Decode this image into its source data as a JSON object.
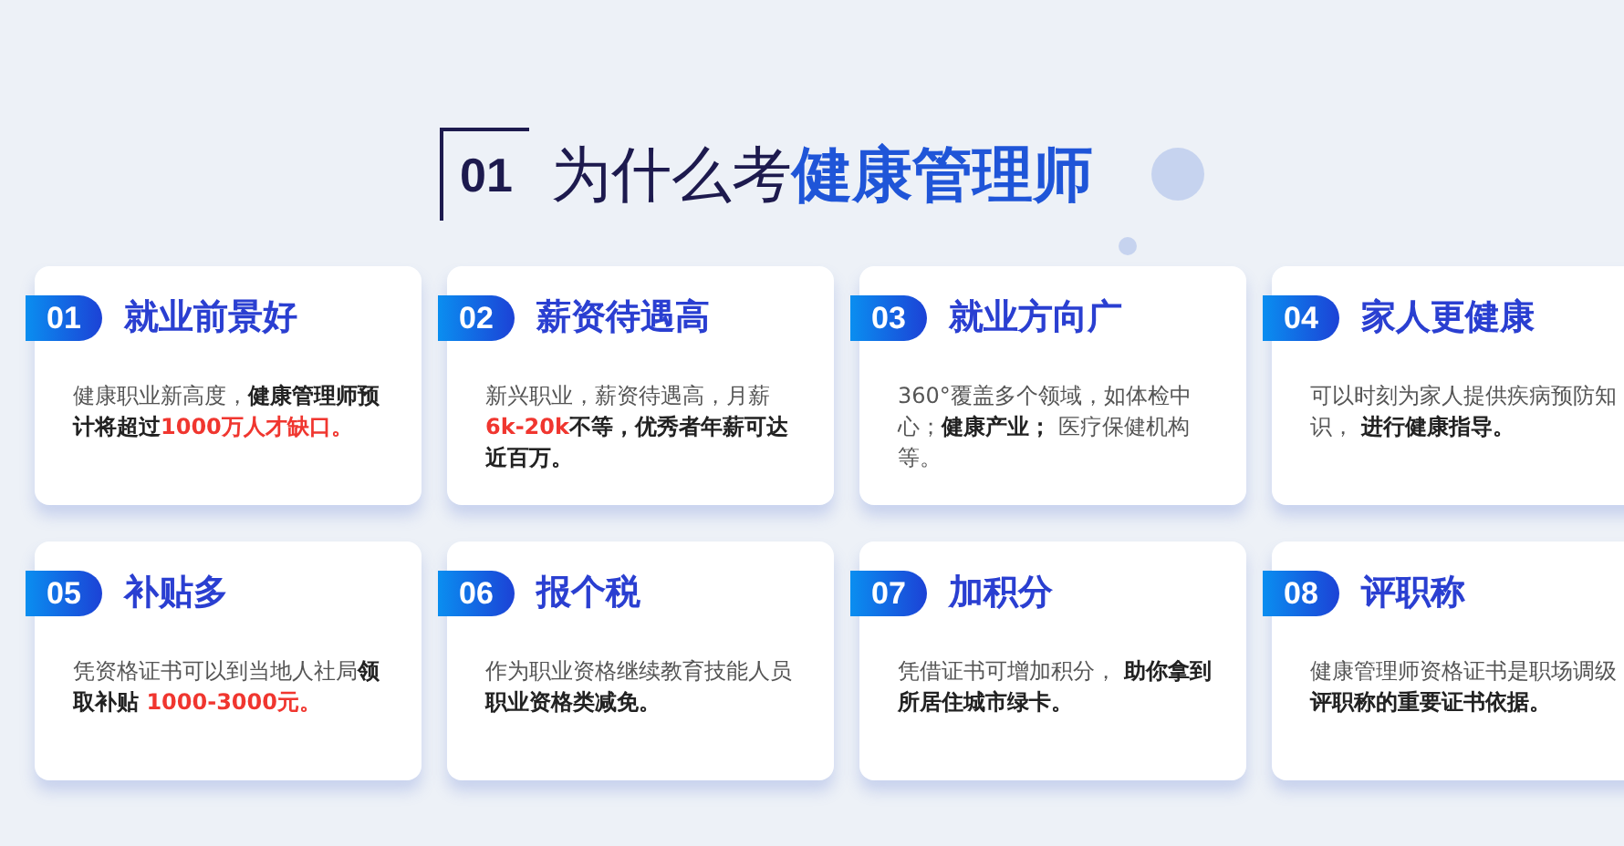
{
  "heading": {
    "number": "01",
    "prefix": "为什么考",
    "highlight": "健康管理师"
  },
  "cards": [
    {
      "number": "01",
      "title": "就业前景好",
      "segments": [
        {
          "text": "健康职业新高度，",
          "kind": "plain"
        },
        {
          "text": "健康管理师预计将超过",
          "kind": "bold"
        },
        {
          "text": "1000万人才缺口。",
          "kind": "highlight"
        }
      ]
    },
    {
      "number": "02",
      "title": "薪资待遇高",
      "segments": [
        {
          "text": "新兴职业，薪资待遇高，月薪",
          "kind": "plain"
        },
        {
          "text": "6k-20k",
          "kind": "highlight"
        },
        {
          "text": "不等，优秀者年薪可达近百万。",
          "kind": "bold"
        }
      ]
    },
    {
      "number": "03",
      "title": "就业方向广",
      "segments": [
        {
          "text": "360°覆盖多个领域，如体检中心；",
          "kind": "plain"
        },
        {
          "text": "健康产业；",
          "kind": "bold"
        },
        {
          "text": " 医疗保健机构等。",
          "kind": "plain"
        }
      ]
    },
    {
      "number": "04",
      "title": "家人更健康",
      "segments": [
        {
          "text": "可以时刻为家人提供疾病预防知识， ",
          "kind": "plain"
        },
        {
          "text": "进行健康指导。",
          "kind": "bold"
        }
      ]
    },
    {
      "number": "05",
      "title": "补贴多",
      "segments": [
        {
          "text": "凭资格证书可以到当地人社局",
          "kind": "plain"
        },
        {
          "text": "领取补贴 ",
          "kind": "bold"
        },
        {
          "text": "1000-3000元。",
          "kind": "highlight"
        }
      ]
    },
    {
      "number": "06",
      "title": "报个税",
      "segments": [
        {
          "text": "作为职业资格继续教育技能人员",
          "kind": "plain"
        },
        {
          "text": "职业资格类减免。",
          "kind": "bold"
        }
      ]
    },
    {
      "number": "07",
      "title": "加积分",
      "segments": [
        {
          "text": "凭借证书可增加积分， ",
          "kind": "plain"
        },
        {
          "text": "助你拿到所居住城市绿卡。",
          "kind": "bold"
        }
      ]
    },
    {
      "number": "08",
      "title": "评职称",
      "segments": [
        {
          "text": "健康管理师资格证书是职场调级",
          "kind": "plain"
        },
        {
          "text": "评职称的重要证书依据。",
          "kind": "bold"
        }
      ]
    }
  ]
}
